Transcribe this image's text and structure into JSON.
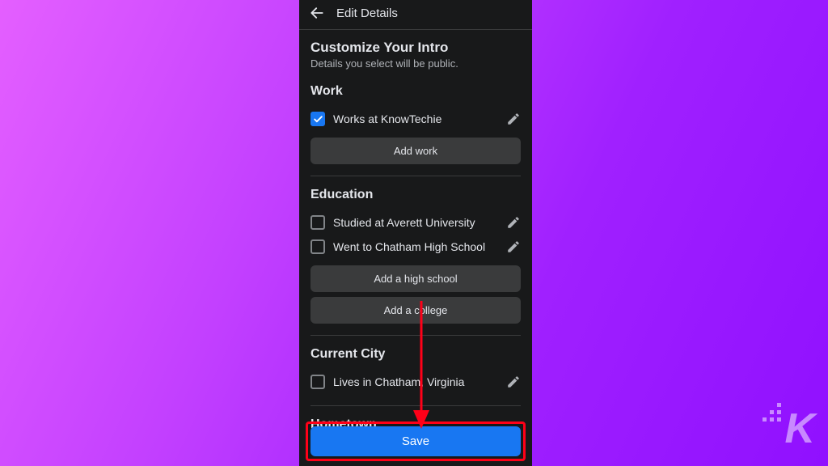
{
  "header": {
    "title": "Edit Details"
  },
  "intro": {
    "title": "Customize Your Intro",
    "subtitle": "Details you select will be public."
  },
  "work": {
    "title": "Work",
    "items": [
      {
        "label": "Works at KnowTechie",
        "checked": true
      }
    ],
    "add_label": "Add work"
  },
  "education": {
    "title": "Education",
    "items": [
      {
        "label": "Studied at Averett University",
        "checked": false
      },
      {
        "label": "Went to Chatham High School",
        "checked": false
      }
    ],
    "add_highschool_label": "Add a high school",
    "add_college_label": "Add a college"
  },
  "current_city": {
    "title": "Current City",
    "items": [
      {
        "label": "Lives in Chatham, Virginia",
        "checked": false
      }
    ]
  },
  "hometown": {
    "title": "Hometown"
  },
  "save": {
    "label": "Save"
  },
  "watermark": {
    "letter": "K"
  },
  "colors": {
    "accent": "#1877f2",
    "annotation": "#ff0018"
  }
}
